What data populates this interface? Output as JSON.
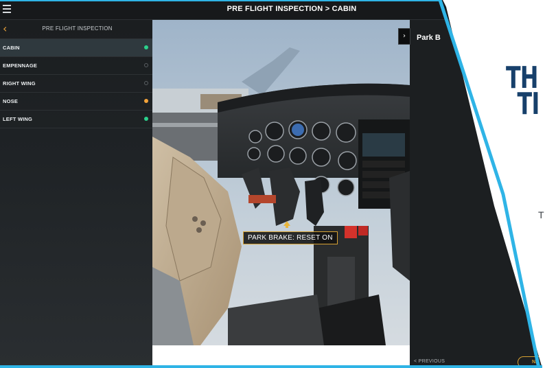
{
  "header": {
    "title": "PRE FLIGHT INSPECTION > CABIN"
  },
  "sidebar": {
    "title": "PRE FLIGHT INSPECTION",
    "items": [
      {
        "label": "CABIN",
        "status_color": "#2bd18c",
        "active": true
      },
      {
        "label": "EMPENNAGE",
        "status_color": "",
        "active": false
      },
      {
        "label": "RIGHT WING",
        "status_color": "",
        "active": false
      },
      {
        "label": "NOSE",
        "status_color": "#f3a33a",
        "active": false
      },
      {
        "label": "LEFT WING",
        "status_color": "#2bd18c",
        "active": false
      }
    ]
  },
  "photo": {
    "hotspot_label": "PARK BRAKE: RESET ON"
  },
  "detail_panel": {
    "title": "Park B",
    "previous_label": "< PREVIOUS",
    "next_label": "NE"
  },
  "promo": {
    "heading_line1": "TH",
    "heading_line2": "TI",
    "subtext": "T"
  },
  "colors": {
    "accent": "#d8a232",
    "status_done": "#2bd18c",
    "status_warning": "#f3a33a",
    "promo_blue": "#17406b",
    "promo_frame": "#2fb4e6"
  }
}
